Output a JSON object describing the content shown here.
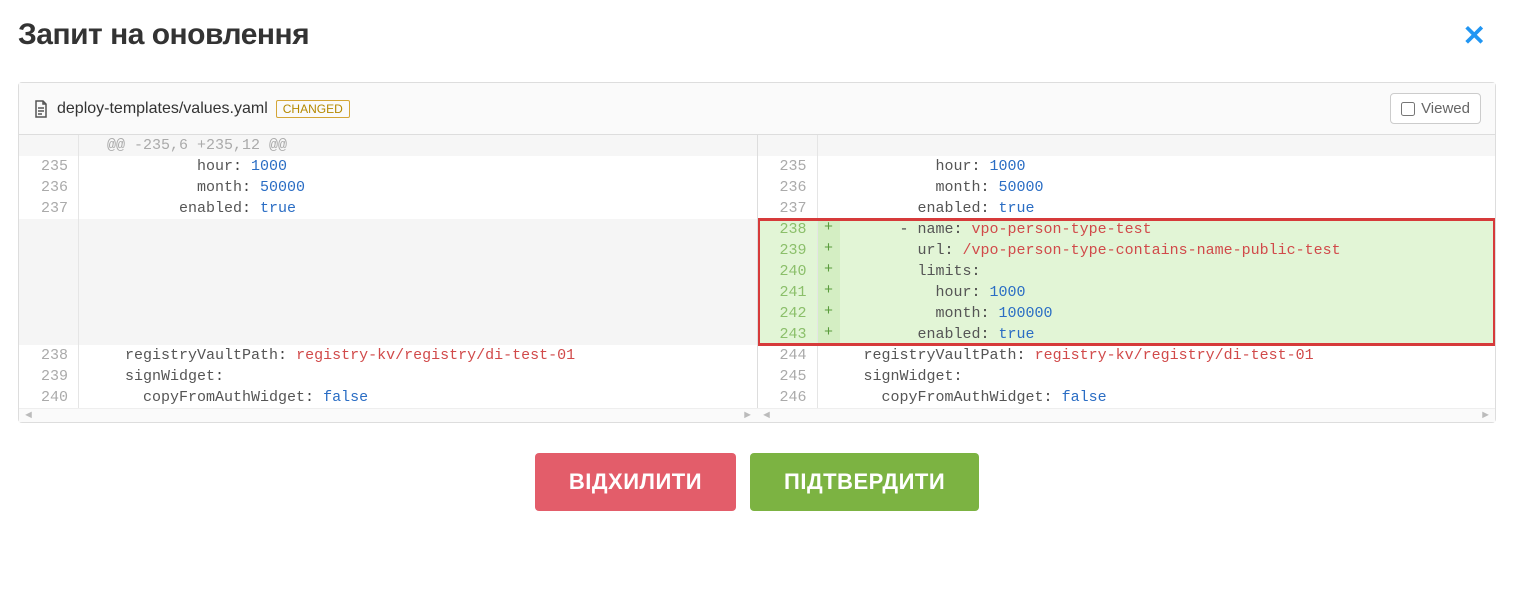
{
  "header": {
    "title": "Запит на оновлення"
  },
  "file": {
    "path": "deploy-templates/values.yaml",
    "badge": "CHANGED",
    "viewed_label": "Viewed",
    "hunk": "@@ -235,6 +235,12 @@"
  },
  "left_lines": [
    {
      "num": "235",
      "indent": 10,
      "key": "hour",
      "val": "1000",
      "valType": "n"
    },
    {
      "num": "236",
      "indent": 10,
      "key": "month",
      "val": "50000",
      "valType": "n"
    },
    {
      "num": "237",
      "indent": 8,
      "key": "enabled",
      "val": "true",
      "valType": "b"
    }
  ],
  "left_tail": [
    {
      "num": "238",
      "indent": 2,
      "key": "registryVaultPath",
      "val": "registry-kv/registry/di-test-01",
      "valType": "s"
    },
    {
      "num": "239",
      "indent": 2,
      "key": "signWidget",
      "val": "",
      "valType": ""
    },
    {
      "num": "240",
      "indent": 4,
      "key": "copyFromAuthWidget",
      "val": "false",
      "valType": "b"
    }
  ],
  "right_lines": [
    {
      "num": "235",
      "indent": 10,
      "key": "hour",
      "val": "1000",
      "valType": "n"
    },
    {
      "num": "236",
      "indent": 10,
      "key": "month",
      "val": "50000",
      "valType": "n"
    },
    {
      "num": "237",
      "indent": 8,
      "key": "enabled",
      "val": "true",
      "valType": "b"
    }
  ],
  "added_lines": [
    {
      "num": "238",
      "indent": 6,
      "prefix": "- ",
      "key": "name",
      "val": "vpo-person-type-test",
      "valType": "s"
    },
    {
      "num": "239",
      "indent": 8,
      "prefix": "",
      "key": "url",
      "val": "/vpo-person-type-contains-name-public-test",
      "valType": "s"
    },
    {
      "num": "240",
      "indent": 8,
      "prefix": "",
      "key": "limits",
      "val": "",
      "valType": ""
    },
    {
      "num": "241",
      "indent": 10,
      "prefix": "",
      "key": "hour",
      "val": "1000",
      "valType": "n"
    },
    {
      "num": "242",
      "indent": 10,
      "prefix": "",
      "key": "month",
      "val": "100000",
      "valType": "n"
    },
    {
      "num": "243",
      "indent": 8,
      "prefix": "",
      "key": "enabled",
      "val": "true",
      "valType": "b"
    }
  ],
  "right_tail": [
    {
      "num": "244",
      "indent": 2,
      "key": "registryVaultPath",
      "val": "registry-kv/registry/di-test-01",
      "valType": "s"
    },
    {
      "num": "245",
      "indent": 2,
      "key": "signWidget",
      "val": "",
      "valType": ""
    },
    {
      "num": "246",
      "indent": 4,
      "key": "copyFromAuthWidget",
      "val": "false",
      "valType": "b"
    }
  ],
  "buttons": {
    "reject": "ВІДХИЛИТИ",
    "approve": "ПІДТВЕРДИТИ"
  }
}
